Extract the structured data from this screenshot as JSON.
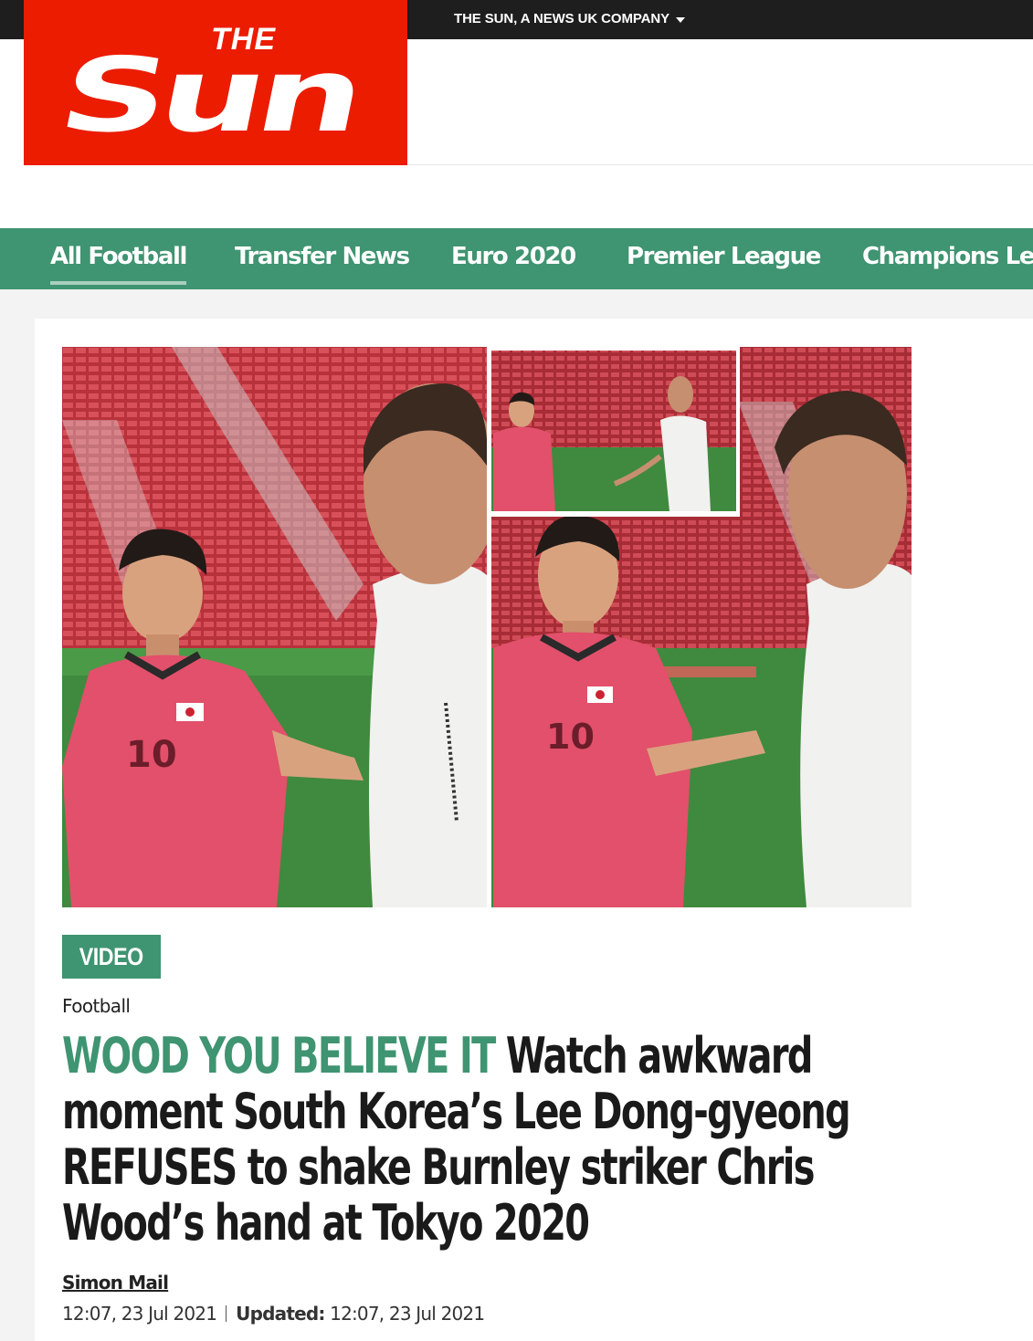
{
  "masthead": {
    "logo_top": "THE",
    "logo_bottom": "Sun",
    "company_menu": "THE SUN, A NEWS UK COMPANY"
  },
  "nav": {
    "items": [
      {
        "label": "All Football",
        "active": true
      },
      {
        "label": "Transfer News"
      },
      {
        "label": "Euro 2020"
      },
      {
        "label": "Premier League"
      },
      {
        "label": "Champions Lea"
      }
    ]
  },
  "article": {
    "badge": "VIDEO",
    "section": "Football",
    "kicker": "WOOD YOU BELIEVE IT",
    "headline": "Watch awkward moment South Korea’s Lee Dong-gyeong REFUSES to shake Burnley striker Chris Wood’s hand at Tokyo 2020",
    "author": "Simon Mail",
    "published": "12:07, 23 Jul 2021",
    "updated_label": "Updated:",
    "updated": "12:07, 23 Jul 2021",
    "image_jersey_number": "10"
  },
  "colors": {
    "brand_red": "#eb1c00",
    "nav_green": "#3f9471",
    "top_bar": "#1e1e1e"
  }
}
